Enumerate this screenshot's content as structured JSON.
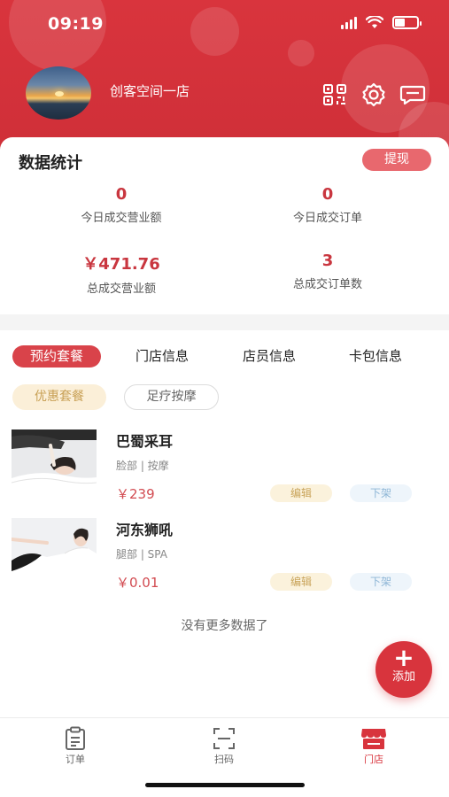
{
  "status_bar": {
    "time": "09:19"
  },
  "header": {
    "store_name": "创客空间一店"
  },
  "stats": {
    "title": "数据统计",
    "withdraw_label": "提现",
    "today_revenue_value": "0",
    "today_revenue_label": "今日成交营业额",
    "today_orders_value": "0",
    "today_orders_label": "今日成交订单",
    "total_revenue_value": "￥471.76",
    "total_revenue_label": "总成交营业额",
    "total_orders_value": "3",
    "total_orders_label": "总成交订单数"
  },
  "tabs": [
    {
      "label": "预约套餐",
      "active": true
    },
    {
      "label": "门店信息",
      "active": false
    },
    {
      "label": "店员信息",
      "active": false
    },
    {
      "label": "卡包信息",
      "active": false
    }
  ],
  "chips": [
    {
      "label": "优惠套餐",
      "active": true
    },
    {
      "label": "足疗按摩",
      "active": false
    }
  ],
  "items": [
    {
      "title": "巴蜀采耳",
      "tags": "脸部 | 按摩",
      "price": "￥239",
      "edit_label": "编辑",
      "off_label": "下架"
    },
    {
      "title": "河东狮吼",
      "tags": "腿部 | SPA",
      "price": "￥0.01",
      "edit_label": "编辑",
      "off_label": "下架"
    }
  ],
  "no_more": "没有更多数据了",
  "fab": {
    "plus": "+",
    "label": "添加"
  },
  "bottom_nav": [
    {
      "label": "订单",
      "icon": "clipboard-icon",
      "active": false
    },
    {
      "label": "扫码",
      "icon": "scan-icon",
      "active": false
    },
    {
      "label": "门店",
      "icon": "store-icon",
      "active": true
    }
  ],
  "colors": {
    "brand": "#d8343d",
    "accent_gold": "#c8a055",
    "light_blue": "#8eb6d6"
  }
}
